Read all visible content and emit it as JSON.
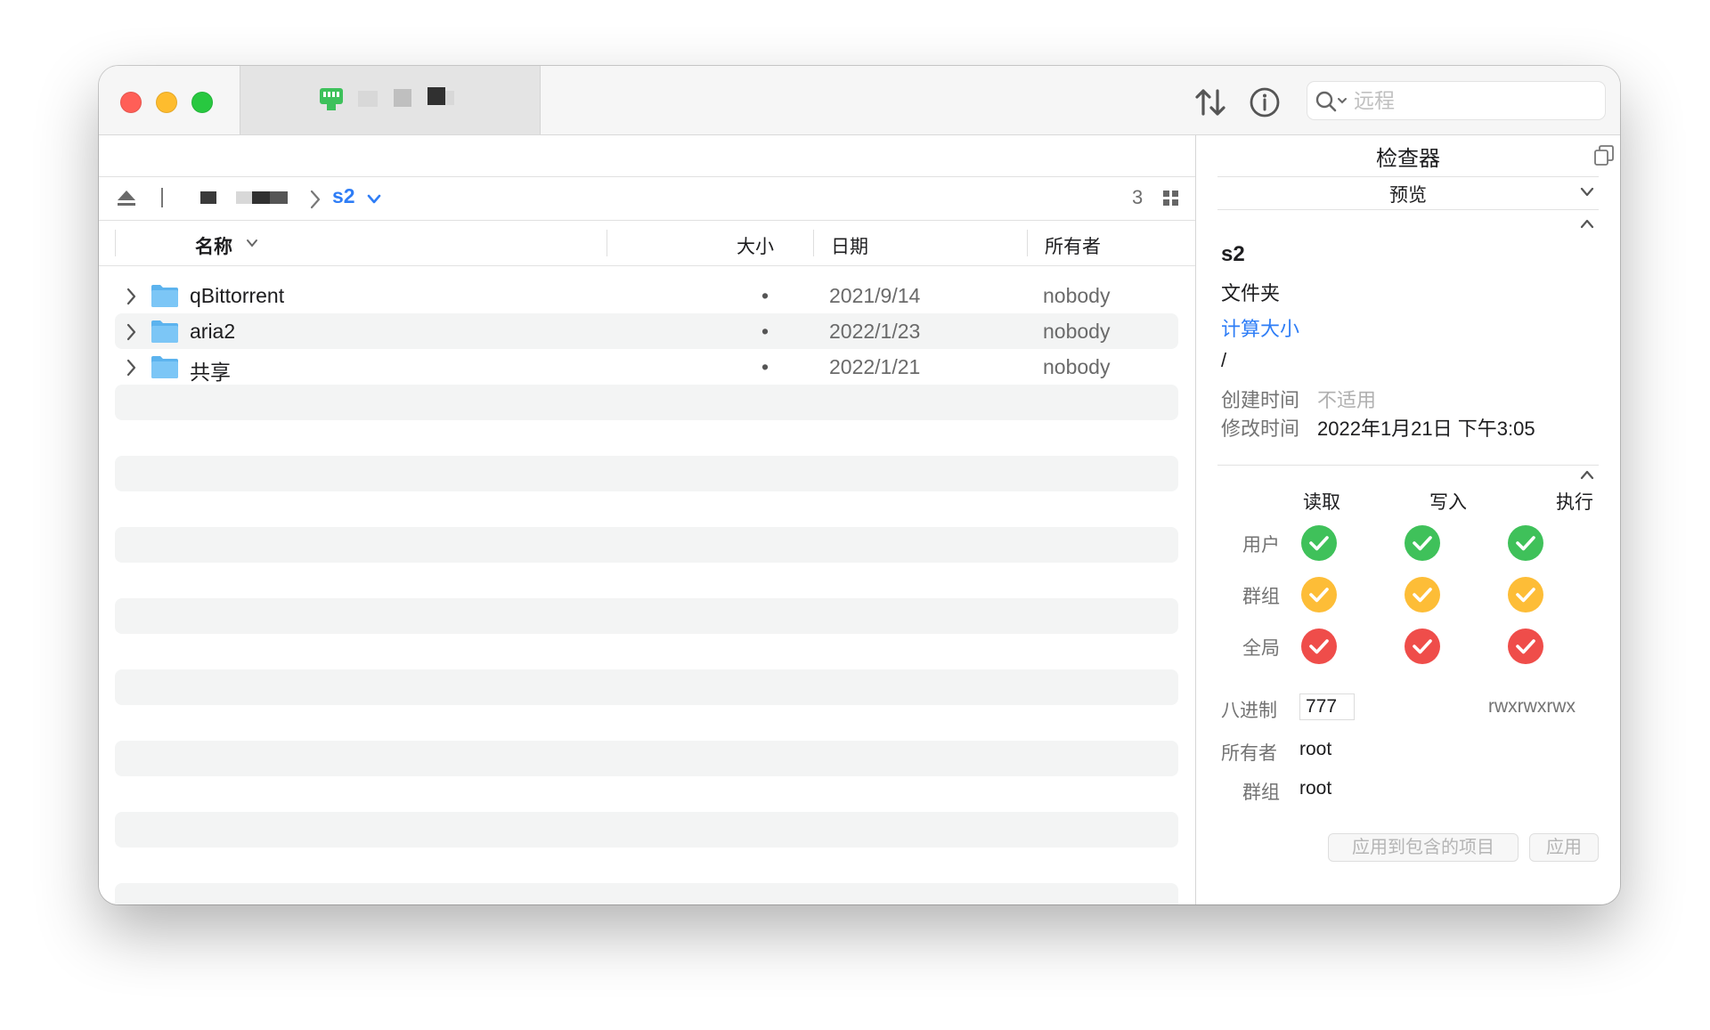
{
  "toolbar": {
    "search_placeholder": "远程"
  },
  "path": {
    "current": "s2",
    "item_count": "3"
  },
  "columns": {
    "name": "名称",
    "size": "大小",
    "date": "日期",
    "owner": "所有者"
  },
  "files": [
    {
      "name": "qBittorrent",
      "size": "•",
      "date": "2021/9/14",
      "owner": "nobody"
    },
    {
      "name": "aria2",
      "size": "•",
      "date": "2022/1/23",
      "owner": "nobody"
    },
    {
      "name": "共享",
      "size": "•",
      "date": "2022/1/21",
      "owner": "nobody"
    }
  ],
  "inspector": {
    "title": "检查器",
    "section": "预览",
    "name": "s2",
    "kind": "文件夹",
    "calc_size": "计算大小",
    "path": "/",
    "created_label": "创建时间",
    "created_value": "不适用",
    "modified_label": "修改时间",
    "modified_value": "2022年1月21日 下午3:05",
    "perm_cols": [
      "读取",
      "写入",
      "执行"
    ],
    "perm_rows": [
      "用户",
      "群组",
      "全局"
    ],
    "perm_colors": [
      "#3fc15a",
      "#fdbd37",
      "#ef4d4a"
    ],
    "octal_label": "八进制",
    "octal_value": "777",
    "symbolic": "rwxrwxrwx",
    "owner_label": "所有者",
    "owner_value": "root",
    "group_label": "群组",
    "group_value": "root",
    "apply_recursive": "应用到包含的项目",
    "apply": "应用"
  }
}
